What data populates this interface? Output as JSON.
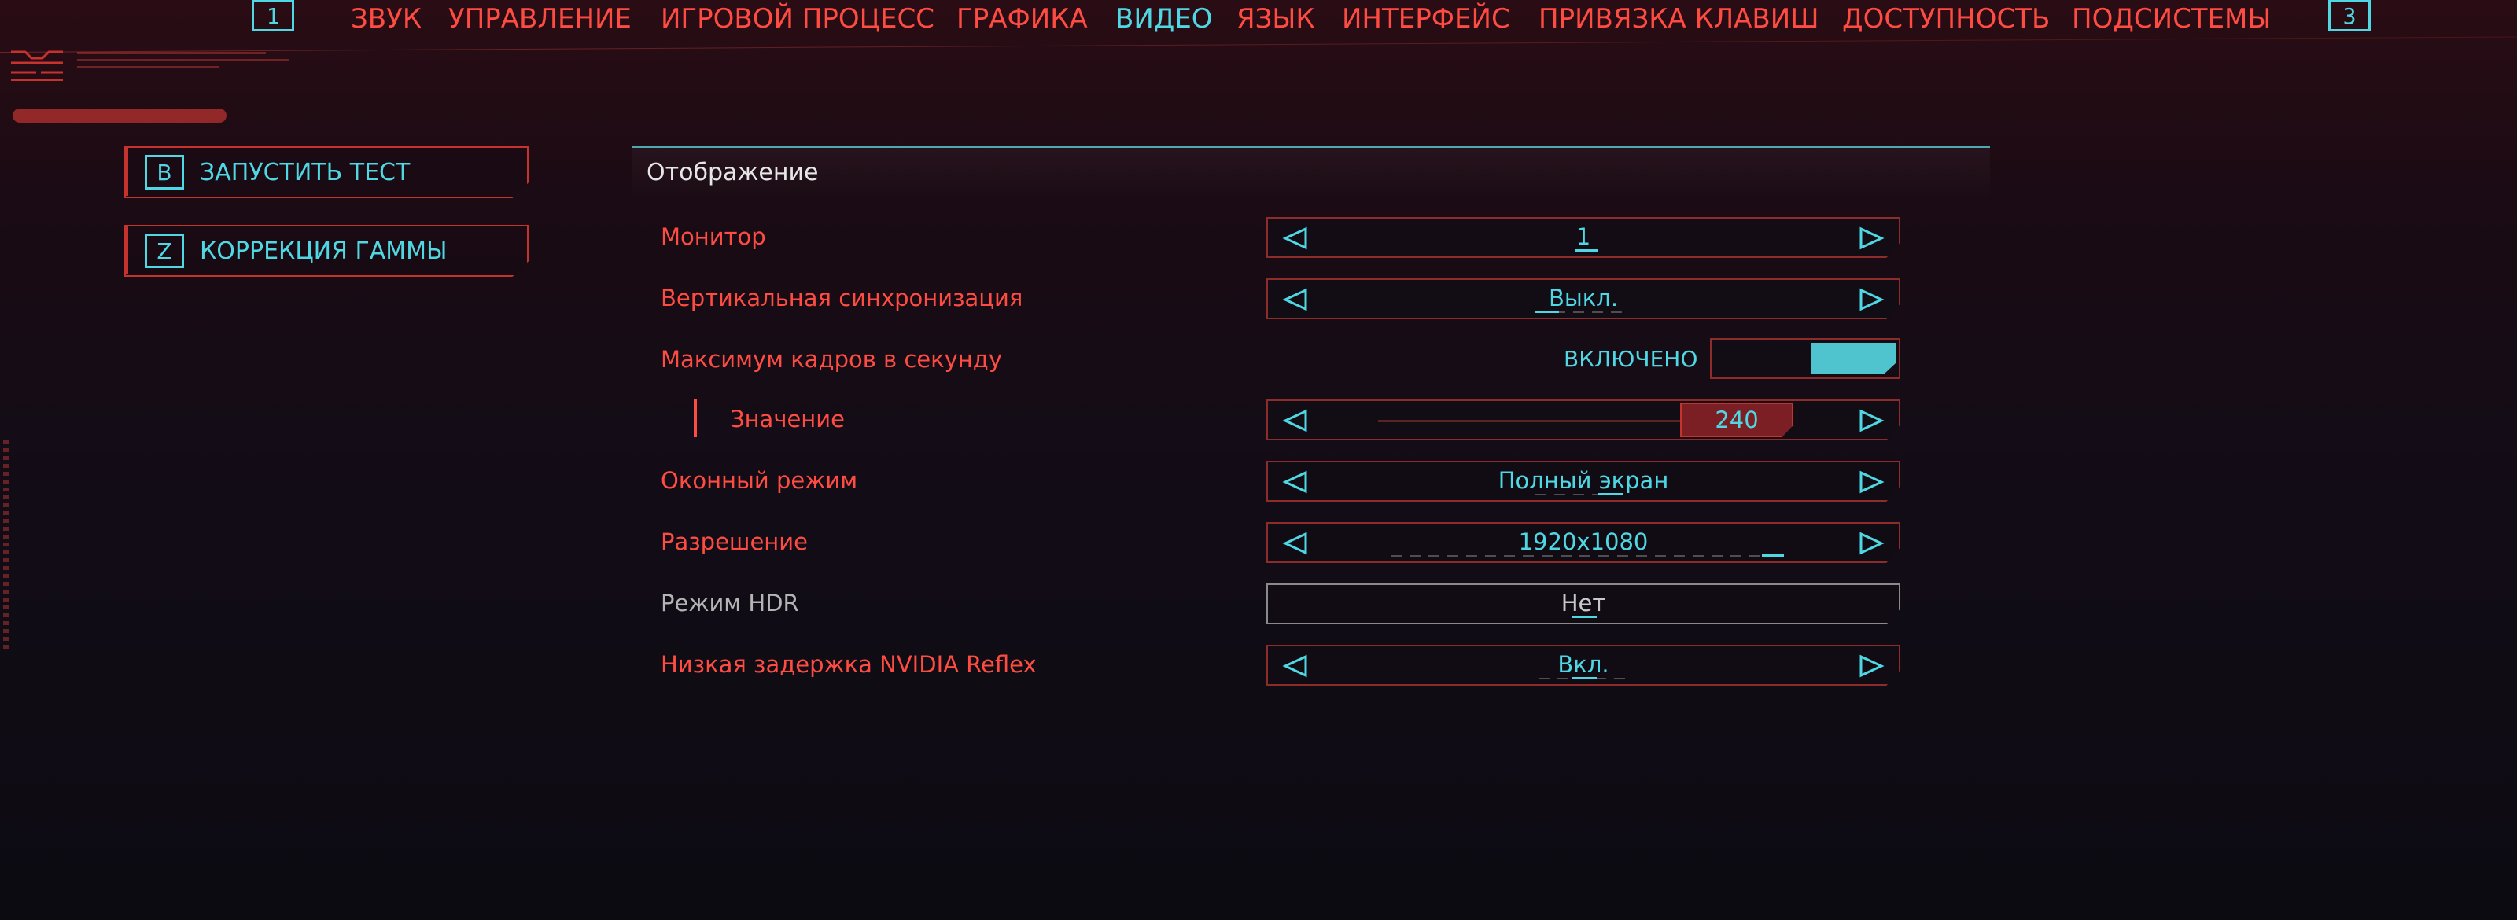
{
  "tabs": {
    "key_left": "1",
    "key_right": "3",
    "items": [
      {
        "label": "ЗВУК"
      },
      {
        "label": "УПРАВЛЕНИЕ"
      },
      {
        "label": "ИГРОВОЙ ПРОЦЕСС"
      },
      {
        "label": "ГРАФИКА"
      },
      {
        "label": "ВИДЕО",
        "active": true
      },
      {
        "label": "ЯЗЫК"
      },
      {
        "label": "ИНТЕРФЕЙС"
      },
      {
        "label": "ПРИВЯЗКА КЛАВИШ"
      },
      {
        "label": "ДОСТУПНОСТЬ"
      },
      {
        "label": "ПОДСИСТЕМЫ"
      }
    ]
  },
  "side_actions": [
    {
      "key": "B",
      "label": "ЗАПУСТИТЬ ТЕСТ"
    },
    {
      "key": "Z",
      "label": "КОРРЕКЦИЯ ГАММЫ"
    }
  ],
  "section": {
    "title": "Отображение"
  },
  "settings": {
    "monitor": {
      "label": "Монитор",
      "value": "1"
    },
    "vsync": {
      "label": "Вертикальная синхронизация",
      "value": "Выкл."
    },
    "max_fps": {
      "label": "Максимум кадров в секунду",
      "value": "ВКЛЮЧЕНО",
      "enabled": true
    },
    "fps_value": {
      "label": "Значение",
      "value": "240",
      "slider_fraction": 0.9
    },
    "window_mode": {
      "label": "Оконный режим",
      "value": "Полный экран"
    },
    "resolution": {
      "label": "Разрешение",
      "value": "1920x1080"
    },
    "hdr": {
      "label": "Режим HDR",
      "value": "Нет"
    },
    "reflex": {
      "label": "Низкая задержка NVIDIA Reflex",
      "value": "Вкл."
    }
  },
  "colors": {
    "accent_cyan": "#4fd8e3",
    "accent_red": "#ff4c42",
    "border_red": "#c6332f"
  },
  "icons": {
    "left_arrow": "triangle-left-icon",
    "right_arrow": "triangle-right-icon"
  }
}
